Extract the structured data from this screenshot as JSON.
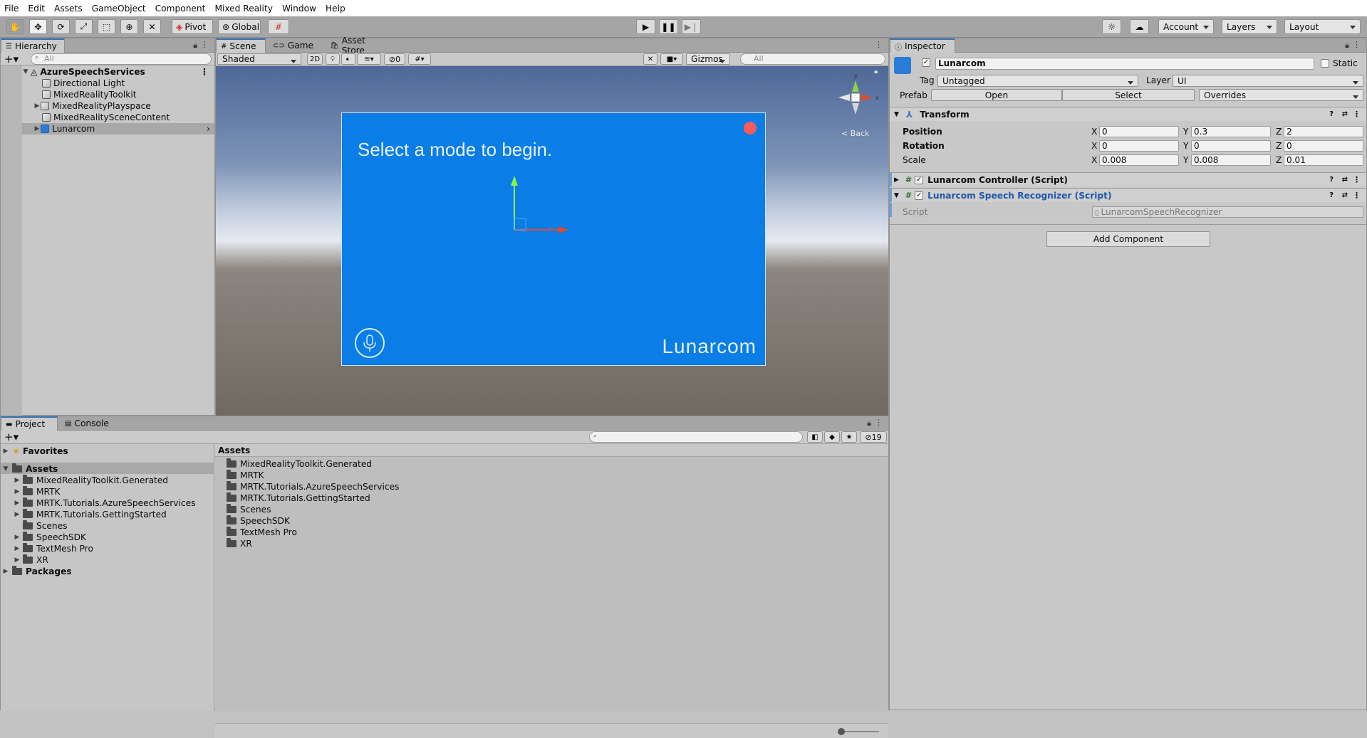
{
  "menu": [
    "File",
    "Edit",
    "Assets",
    "GameObject",
    "Component",
    "Mixed Reality",
    "Window",
    "Help"
  ],
  "toolbar": {
    "pivot": "Pivot",
    "global": "Global",
    "account": "Account",
    "layers": "Layers",
    "layout": "Layout"
  },
  "hierarchy": {
    "tab": "Hierarchy",
    "search_placeholder": "All",
    "scene": "AzureSpeechServices",
    "items": [
      "Directional Light",
      "MixedRealityToolkit",
      "MixedRealityPlayspace",
      "MixedRealitySceneContent",
      "Lunarcom"
    ]
  },
  "scene_view": {
    "tabs": [
      "Scene",
      "Game",
      "Asset Store"
    ],
    "shading": "Shaded",
    "mode_2d": "2D",
    "hidden_count": "0",
    "gizmos": "Gizmos",
    "search_placeholder": "All",
    "back_label": "Back",
    "panel_prompt": "Select a mode to begin.",
    "panel_brand": "Lunarcom",
    "panel_color": "#0a7de6"
  },
  "inspector": {
    "tab": "Inspector",
    "object_name": "Lunarcom",
    "static_label": "Static",
    "tag_label": "Tag",
    "tag_value": "Untagged",
    "layer_label": "Layer",
    "layer_value": "UI",
    "prefab_label": "Prefab",
    "prefab_open": "Open",
    "prefab_select": "Select",
    "prefab_overrides": "Overrides",
    "transform": {
      "title": "Transform",
      "position_label": "Position",
      "rotation_label": "Rotation",
      "scale_label": "Scale",
      "position": {
        "x": "0",
        "y": "0.3",
        "z": "2"
      },
      "rotation": {
        "x": "0",
        "y": "0",
        "z": "0"
      },
      "scale": {
        "x": "0.008",
        "y": "0.008",
        "z": "0.01"
      }
    },
    "components": [
      "Lunarcom Controller (Script)",
      "Lunarcom Speech Recognizer (Script)"
    ],
    "script_label": "Script",
    "script_value": "LunarcomSpeechRecognizer",
    "add_component": "Add Component"
  },
  "project": {
    "tabs": [
      "Project",
      "Console"
    ],
    "hidden_count": "19",
    "favorites": "Favorites",
    "assets_root": "Assets",
    "tree": [
      "MixedRealityToolkit.Generated",
      "MRTK",
      "MRTK.Tutorials.AzureSpeechServices",
      "MRTK.Tutorials.GettingStarted",
      "Scenes",
      "SpeechSDK",
      "TextMesh Pro",
      "XR"
    ],
    "packages": "Packages",
    "breadcrumb": "Assets",
    "folders": [
      "MixedRealityToolkit.Generated",
      "MRTK",
      "MRTK.Tutorials.AzureSpeechServices",
      "MRTK.Tutorials.GettingStarted",
      "Scenes",
      "SpeechSDK",
      "TextMesh Pro",
      "XR"
    ]
  }
}
